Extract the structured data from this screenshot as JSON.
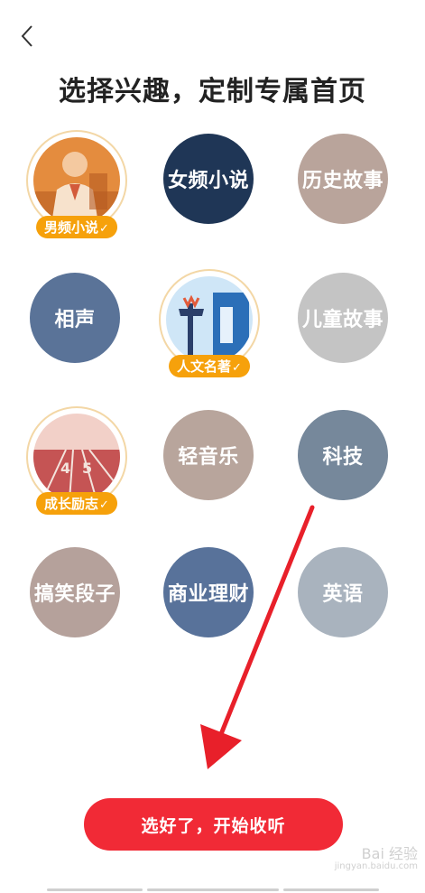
{
  "header": {
    "back_icon": "chevron-left-icon",
    "title": "选择兴趣，定制专属首页"
  },
  "interests": [
    {
      "label": "男频小说",
      "selected": true,
      "color": "#e8873a"
    },
    {
      "label": "女频小说",
      "selected": false,
      "color": "#1f3656"
    },
    {
      "label": "历史故事",
      "selected": false,
      "color": "#b9a49b"
    },
    {
      "label": "相声",
      "selected": false,
      "color": "#5a7398"
    },
    {
      "label": "人文名著",
      "selected": true,
      "color": "#cfe6f7"
    },
    {
      "label": "儿童故事",
      "selected": false,
      "color": "#c4c4c4"
    },
    {
      "label": "成长励志",
      "selected": true,
      "color": "#c85a5a"
    },
    {
      "label": "轻音乐",
      "selected": false,
      "color": "#b8a59c"
    },
    {
      "label": "科技",
      "selected": false,
      "color": "#76889b"
    },
    {
      "label": "搞笑段子",
      "selected": false,
      "color": "#b5a19b"
    },
    {
      "label": "商业理财",
      "selected": false,
      "color": "#58729a"
    },
    {
      "label": "英语",
      "selected": false,
      "color": "#a9b3be"
    }
  ],
  "check_mark": "✓",
  "cta": {
    "label": "选好了，开始收听"
  },
  "watermark": {
    "text": "Bai 经验",
    "sub": "jingyan.baidu.com"
  },
  "annotation": {
    "arrow_color": "#e8202a"
  }
}
